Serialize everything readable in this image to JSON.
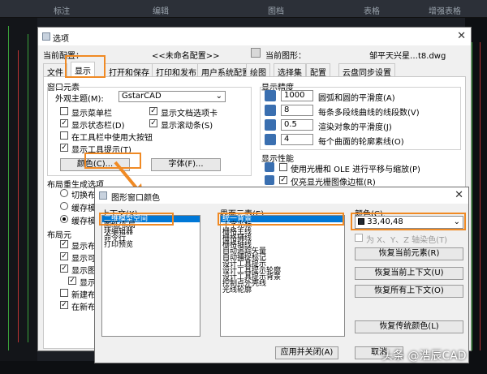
{
  "cad": {
    "toolbar": [
      "标注",
      "编辑",
      "图档",
      "表格",
      "增强表格"
    ]
  },
  "options": {
    "title": "选项",
    "current_profile_label": "当前配置：",
    "current_profile_value": "<<未命名配置>>",
    "current_drawing_label": "当前图形：",
    "current_drawing_value": "邹平天兴星…t8.dwg",
    "tabs": [
      "文件",
      "显示",
      "打开和保存",
      "打印和发布",
      "用户系统配置",
      "绘图",
      "选择集",
      "配置",
      "云盘同步设置"
    ],
    "window_elements": {
      "group_title": "窗口元素",
      "theme_label": "外观主题(M):",
      "theme_value": "GstarCAD",
      "checks_left": [
        {
          "label": "显示菜单栏",
          "checked": false
        },
        {
          "label": "显示状态栏(D)",
          "checked": true
        },
        {
          "label": "在工具栏中使用大按钮",
          "checked": false
        },
        {
          "label": "显示工具提示(T)",
          "checked": true
        }
      ],
      "checks_right": [
        {
          "label": "显示文档选项卡",
          "checked": true
        },
        {
          "label": "显示滚动条(S)",
          "checked": true
        }
      ],
      "color_button": "颜色(C)...",
      "font_button": "字体(F)..."
    },
    "display_precision": {
      "group_title": "显示精度",
      "rows": [
        {
          "value": "1000",
          "label": "圆弧和圆的平滑度(A)"
        },
        {
          "value": "8",
          "label": "每条多段线曲线的线段数(V)"
        },
        {
          "value": "0.5",
          "label": "渲染对象的平滑度(J)"
        },
        {
          "value": "4",
          "label": "每个曲面的轮廓素线(O)"
        }
      ]
    },
    "display_performance": {
      "group_title": "显示性能",
      "checks": [
        {
          "label": "使用光栅和 OLE 进行平移与缩放(P)",
          "checked": false
        },
        {
          "label": "仅亮显光栅图像边框(R)",
          "checked": true
        }
      ]
    },
    "layout_regen": {
      "group_title": "布局重生成选项",
      "options": [
        {
          "label": "切换布",
          "on": false
        },
        {
          "label": "缓存模",
          "on": false
        },
        {
          "label": "缓存模",
          "on": true
        }
      ]
    },
    "layout_elements": {
      "group_title": "布局元",
      "checks": [
        {
          "label": "显示布",
          "checked": true
        },
        {
          "label": "显示可",
          "checked": true
        },
        {
          "label": "显示图",
          "checked": true
        },
        {
          "label": "显示",
          "checked": true
        },
        {
          "label": "新建布",
          "checked": false
        },
        {
          "label": "在新布",
          "checked": true
        }
      ]
    }
  },
  "color_dialog": {
    "title": "图形窗口颜色",
    "context_label": "上下文(X):",
    "contexts": [
      "二维模型空间",
      "图纸/布局",
      "块编辑器",
      "命令行",
      "打印预览"
    ],
    "selected_context": 0,
    "elements_label": "界面元素(E):",
    "elements": [
      "统一背景",
      "十字光标",
      "栅格主线",
      "栅格辅线",
      "栅格轴线",
      "自动追踪矢量",
      "自动捕捉标记",
      "设计工具提示",
      "设计工具提示轮廓",
      "设计工具提示背景",
      "控制点外壳线",
      "光线轮廓"
    ],
    "selected_element": 0,
    "color_label": "颜色(C):",
    "color_value": "33,40,48",
    "color_swatch": "#212830",
    "xyz_tint_label": "为 X、Y、Z 轴染色(T)",
    "buttons": {
      "restore_current_element": "恢复当前元素(R)",
      "restore_current_context": "恢复当前上下文(U)",
      "restore_all_contexts": "恢复所有上下文(O)",
      "restore_classic_colors": "恢复传统颜色(L)",
      "apply_close": "应用并关闭(A)",
      "cancel": "取消"
    }
  },
  "watermark": "头条 @浩辰CAD"
}
